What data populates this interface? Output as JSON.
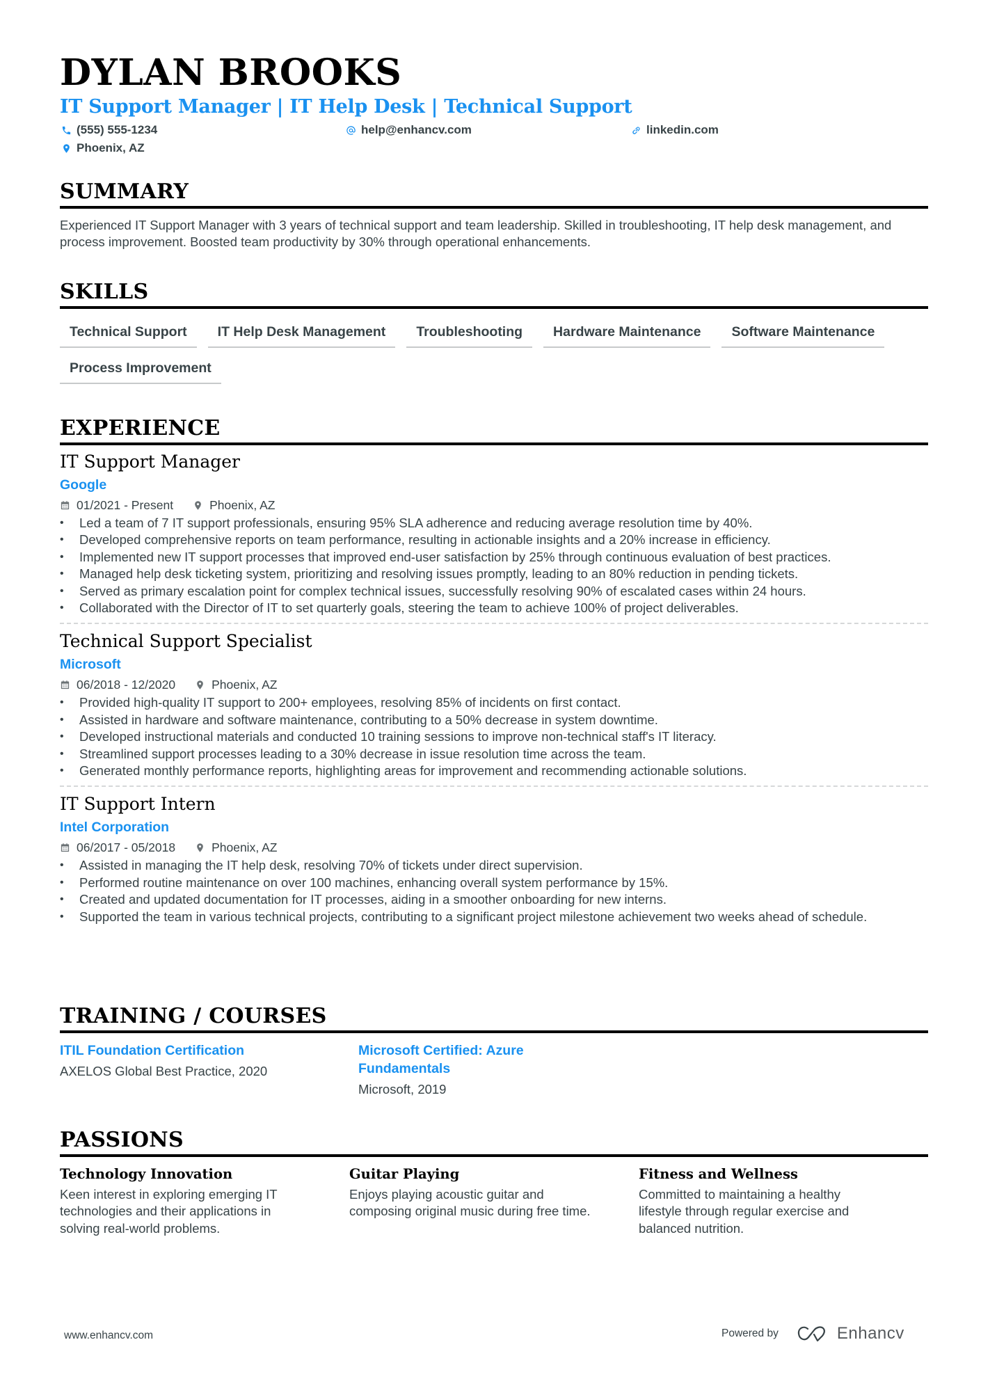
{
  "header": {
    "name": "DYLAN BROOKS",
    "headline": "IT Support Manager | IT Help Desk | Technical Support",
    "contacts": [
      {
        "icon": "phone-icon",
        "value": "(555) 555-1234"
      },
      {
        "icon": "at-icon",
        "value": "help@enhancv.com"
      },
      {
        "icon": "link-icon",
        "value": "linkedin.com"
      },
      {
        "icon": "location-pin-icon",
        "value": "Phoenix, AZ"
      }
    ]
  },
  "summary": {
    "title": "SUMMARY",
    "text": "Experienced IT Support Manager with 3 years of technical support and team leadership. Skilled in troubleshooting, IT help desk management, and process improvement. Boosted team productivity by 30% through operational enhancements."
  },
  "skills": {
    "title": "SKILLS",
    "items": [
      "Technical Support",
      "IT Help Desk Management",
      "Troubleshooting",
      "Hardware Maintenance",
      "Software Maintenance",
      "Process Improvement"
    ]
  },
  "experience": {
    "title": "EXPERIENCE",
    "jobs": [
      {
        "role": "IT Support Manager",
        "company": "Google",
        "dates": "01/2021 - Present",
        "location": "Phoenix, AZ",
        "bullets": [
          "Led a team of 7 IT support professionals, ensuring 95% SLA adherence and reducing average resolution time by 40%.",
          "Developed comprehensive reports on team performance, resulting in actionable insights and a 20% increase in efficiency.",
          "Implemented new IT support processes that improved end-user satisfaction by 25% through continuous evaluation of best practices.",
          "Managed help desk ticketing system, prioritizing and resolving issues promptly, leading to an 80% reduction in pending tickets.",
          "Served as primary escalation point for complex technical issues, successfully resolving 90% of escalated cases within 24 hours.",
          "Collaborated with the Director of IT to set quarterly goals, steering the team to achieve 100% of project deliverables."
        ]
      },
      {
        "role": "Technical Support Specialist",
        "company": "Microsoft",
        "dates": "06/2018 - 12/2020",
        "location": "Phoenix, AZ",
        "bullets": [
          "Provided high-quality IT support to 200+ employees, resolving 85% of incidents on first contact.",
          "Assisted in hardware and software maintenance, contributing to a 50% decrease in system downtime.",
          "Developed instructional materials and conducted 10 training sessions to improve non-technical staff's IT literacy.",
          "Streamlined support processes leading to a 30% decrease in issue resolution time across the team.",
          "Generated monthly performance reports, highlighting areas for improvement and recommending actionable solutions."
        ]
      },
      {
        "role": "IT Support Intern",
        "company": "Intel Corporation",
        "dates": "06/2017 - 05/2018",
        "location": "Phoenix, AZ",
        "bullets": [
          "Assisted in managing the IT help desk, resolving 70% of tickets under direct supervision.",
          "Performed routine maintenance on over 100 machines, enhancing overall system performance by 15%.",
          "Created and updated documentation for IT processes, aiding in a smoother onboarding for new interns.",
          "Supported the team in various technical projects, contributing to a significant project milestone achievement two weeks ahead of schedule."
        ]
      }
    ]
  },
  "training": {
    "title": "TRAINING / COURSES",
    "items": [
      {
        "name": "ITIL Foundation Certification",
        "sub": "AXELOS Global Best Practice, 2020"
      },
      {
        "name": "Microsoft Certified: Azure Fundamentals",
        "sub": "Microsoft, 2019"
      }
    ]
  },
  "passions": {
    "title": "PASSIONS",
    "items": [
      {
        "title": "Technology Innovation",
        "desc": "Keen interest in exploring emerging IT technologies and their applications in solving real-world problems."
      },
      {
        "title": "Guitar Playing",
        "desc": "Enjoys playing acoustic guitar and composing original music during free time."
      },
      {
        "title": "Fitness and Wellness",
        "desc": "Committed to maintaining a healthy lifestyle through regular exercise and balanced nutrition."
      }
    ]
  },
  "footer": {
    "website": "www.enhancv.com",
    "powered_by": "Powered by",
    "brand": "Enhancv"
  },
  "colors": {
    "accent": "#1a91f0",
    "text": "#384347",
    "heading": "#000000"
  }
}
